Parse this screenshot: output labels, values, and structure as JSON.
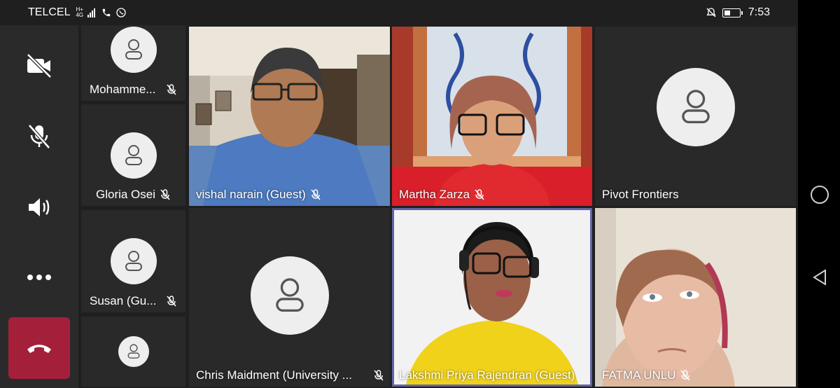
{
  "status": {
    "carrier": "TELCEL",
    "network_top": "H+",
    "network_bottom": "4G",
    "time": "7:53"
  },
  "controls": {
    "camera_icon": "camera-off-icon",
    "mic_icon": "mic-off-icon",
    "speaker_icon": "speaker-icon",
    "more_icon": "more-icon",
    "hangup_icon": "hangup-icon",
    "hangup_color": "#a4203a"
  },
  "side_participants": [
    {
      "name": "Mohamme..."
    },
    {
      "name": "Gloria Osei"
    },
    {
      "name": "Susan (Gu..."
    },
    {
      "name": ""
    }
  ],
  "tiles": [
    {
      "name": "vishal narain (Guest)"
    },
    {
      "name": "Martha Zarza"
    },
    {
      "name": "Pivot Frontiers"
    },
    {
      "name": "Chris Maidment (University ..."
    },
    {
      "name": "Lakshmi Priya Rajendran (Guest)"
    },
    {
      "name": "FATMA UNLU"
    }
  ],
  "colors": {
    "background": "#1f1f1f",
    "tile": "#292929",
    "active_speaker_border": "#6264a7"
  }
}
